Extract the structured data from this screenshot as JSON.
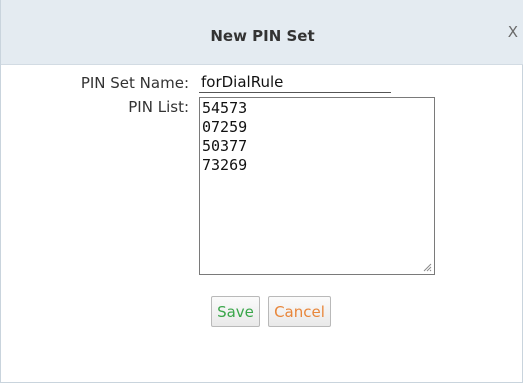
{
  "dialog": {
    "title": "New PIN Set",
    "close_label": "X"
  },
  "form": {
    "pin_set_name_label": "PIN Set Name:",
    "pin_set_name_value": "forDialRule",
    "pin_list_label": "PIN List:",
    "pin_list_values": [
      "54573",
      "07259",
      "50377",
      "73269"
    ]
  },
  "buttons": {
    "save_label": "Save",
    "cancel_label": "Cancel"
  },
  "colors": {
    "titlebar_bg": "#e4ebf1",
    "save_text": "#3aa64a",
    "cancel_text": "#e8863a"
  }
}
